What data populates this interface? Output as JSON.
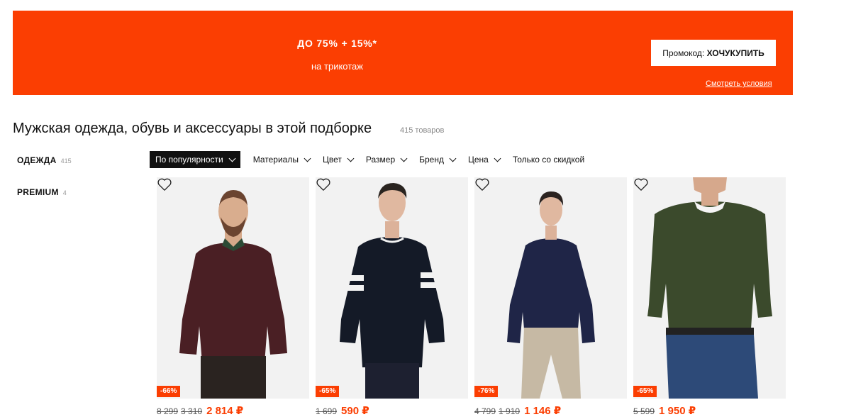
{
  "banner": {
    "headline": "ДО 75% + 15%*",
    "subline": "на трикотаж",
    "promo_label": "Промокод:",
    "promo_code": "ХОЧУКУПИТЬ",
    "conditions": "Смотреть условия",
    "bg_color": "#fb3e02"
  },
  "heading": {
    "title": "Мужская одежда, обувь и аксессуары в этой подборке",
    "count": "415 товаров"
  },
  "sidebar": [
    {
      "label": "ОДЕЖДА",
      "count": "415"
    },
    {
      "label": "PREMIUM",
      "count": "4"
    }
  ],
  "filters": [
    {
      "label": "По популярности",
      "active": true,
      "dropdown": true
    },
    {
      "label": "Материалы",
      "active": false,
      "dropdown": true
    },
    {
      "label": "Цвет",
      "active": false,
      "dropdown": true
    },
    {
      "label": "Размер",
      "active": false,
      "dropdown": true
    },
    {
      "label": "Бренд",
      "active": false,
      "dropdown": true
    },
    {
      "label": "Цена",
      "active": false,
      "dropdown": true
    },
    {
      "label": "Только со скидкой",
      "active": false,
      "dropdown": false
    }
  ],
  "products": [
    {
      "discount": "-66%",
      "old_price": "8 299",
      "old_price2": "3 310",
      "price": "2 814 ₽",
      "sweater_color": "#4a1f24"
    },
    {
      "discount": "-65%",
      "old_price": "1 699",
      "old_price2": "",
      "price": "590 ₽",
      "sweater_color": "#141a27"
    },
    {
      "discount": "-76%",
      "old_price": "4 799",
      "old_price2": "1 910",
      "price": "1 146 ₽",
      "sweater_color": "#1f2547"
    },
    {
      "discount": "-65%",
      "old_price": "5 599",
      "old_price2": "",
      "price": "1 950 ₽",
      "sweater_color": "#3b4a2c"
    }
  ]
}
